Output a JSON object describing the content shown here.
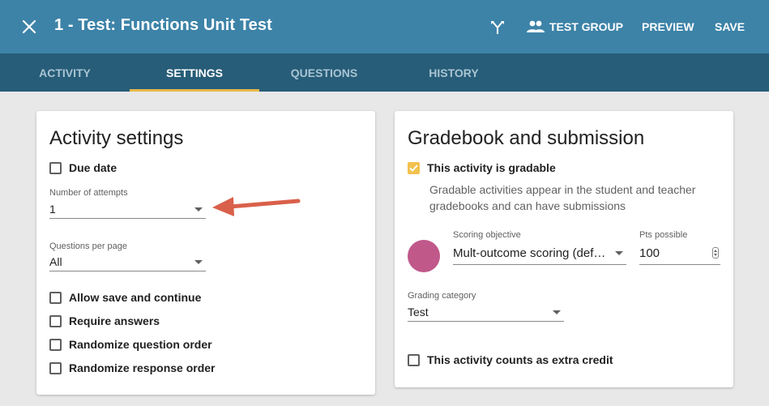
{
  "header": {
    "title": "1 - Test: Functions Unit Test",
    "test_group_label": "TEST GROUP",
    "preview_label": "PREVIEW",
    "save_label": "SAVE"
  },
  "tabs": [
    {
      "label": "ACTIVITY",
      "active": false
    },
    {
      "label": "SETTINGS",
      "active": true
    },
    {
      "label": "QUESTIONS",
      "active": false
    },
    {
      "label": "HISTORY",
      "active": false
    }
  ],
  "activity_settings": {
    "title": "Activity settings",
    "due_date_label": "Due date",
    "attempts_label": "Number of attempts",
    "attempts_value": "1",
    "questions_per_page_label": "Questions per page",
    "questions_per_page_value": "All",
    "options": [
      {
        "label": "Allow save and continue",
        "checked": false
      },
      {
        "label": "Require answers",
        "checked": false
      },
      {
        "label": "Randomize question order",
        "checked": false
      },
      {
        "label": "Randomize response order",
        "checked": false
      }
    ]
  },
  "gradebook": {
    "title": "Gradebook and submission",
    "gradable_label": "This activity is gradable",
    "gradable_checked": true,
    "description": "Gradable activities appear in the student and teacher gradebooks and can have submissions",
    "scoring_objective_label": "Scoring objective",
    "scoring_objective_value": "Mult-outcome scoring (default)",
    "pts_possible_label": "Pts possible",
    "pts_possible_value": "100",
    "grading_category_label": "Grading category",
    "grading_category_value": "Test",
    "extra_credit_label": "This activity counts as extra credit",
    "extra_credit_checked": false
  },
  "colors": {
    "header_bg": "#3d83a8",
    "tabbar_bg": "#275d78",
    "tab_indicator": "#e8b84a",
    "checkbox_checked": "#f2c14e",
    "scoring_circle": "#c0588a",
    "annotation_arrow": "#d9604a"
  }
}
